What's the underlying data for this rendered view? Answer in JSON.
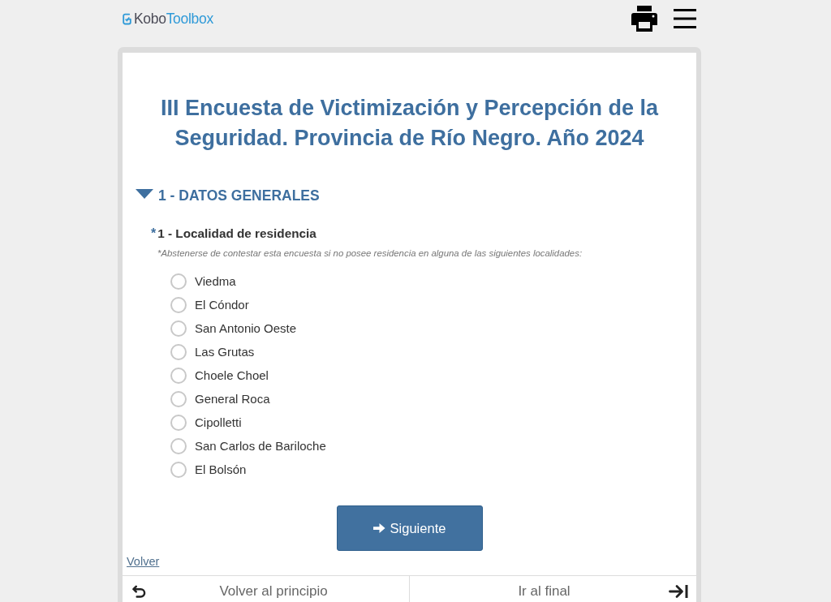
{
  "header": {
    "logo": {
      "first": "Kobo",
      "second": "Toolbox"
    }
  },
  "form": {
    "title": "III Encuesta de Victimización y Percepción de la Seguridad. Provincia de Río Negro. Año 2024",
    "group": {
      "title": "1 - DATOS GENERALES",
      "expanded": true,
      "question": {
        "required_mark": "*",
        "label": "1 - Localidad de residencia",
        "hint": "*Abstenerse de contestar esta encuesta si no posee residencia en alguna de las siguientes localidades:",
        "options": [
          {
            "label": "Viedma",
            "selected": false
          },
          {
            "label": "El Cóndor",
            "selected": false
          },
          {
            "label": "San Antonio Oeste",
            "selected": false
          },
          {
            "label": "Las Grutas",
            "selected": false
          },
          {
            "label": "Choele Choel",
            "selected": false
          },
          {
            "label": "General Roca",
            "selected": false
          },
          {
            "label": "Cipolletti",
            "selected": false
          },
          {
            "label": "San Carlos de Bariloche",
            "selected": false
          },
          {
            "label": "El Bolsón",
            "selected": false
          }
        ]
      }
    },
    "next_button": "Siguiente",
    "back_link": "Volver"
  },
  "footer": {
    "start": "Volver al principio",
    "end": "Ir al final"
  }
}
